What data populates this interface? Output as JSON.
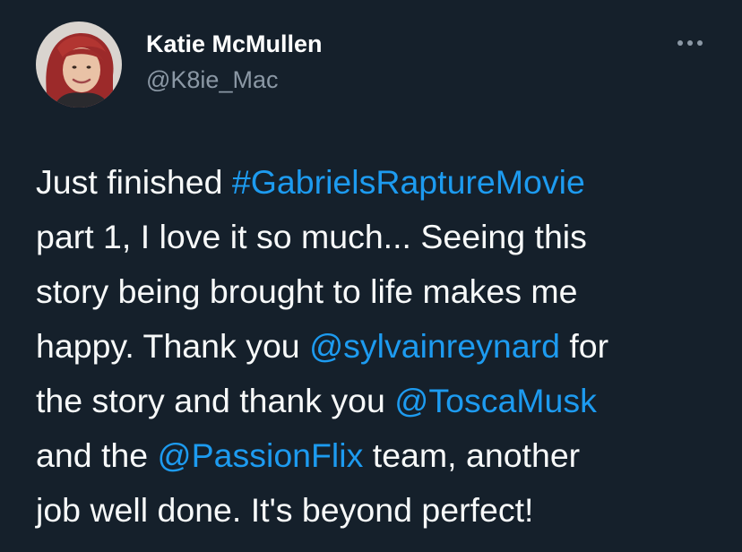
{
  "author": {
    "display_name": "Katie McMullen",
    "handle": "@K8ie_Mac",
    "avatar_icon": "profile-photo"
  },
  "more_icon": "more-horizontal-icon",
  "colors": {
    "background": "#15202b",
    "text": "#f7f9f9",
    "secondary_text": "#8b98a5",
    "link": "#1d9bf0"
  },
  "tweet": {
    "lines": [
      {
        "t1": "Just finished ",
        "hashtag": "#GabrielsRaptureMovie"
      },
      {
        "t1": "part 1, I love it so much... Seeing this"
      },
      {
        "t1": "story being brought to life makes me"
      },
      {
        "t1": "happy. Thank you ",
        "mention": "@sylvainreynard",
        "t2": " for"
      },
      {
        "t1": "the story and thank you ",
        "mention": "@ToscaMusk"
      },
      {
        "t1": "and the ",
        "mention": "@PassionFlix",
        "t2": " team, another"
      },
      {
        "t1": "job well done. It's beyond perfect!"
      }
    ]
  }
}
